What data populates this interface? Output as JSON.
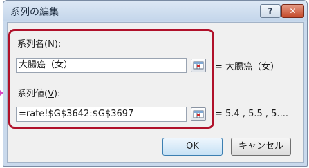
{
  "dialog": {
    "title": "系列の編集",
    "help_label": "?",
    "close_label": "✕"
  },
  "series_name": {
    "label_prefix": "系列名(",
    "label_accel": "N",
    "label_suffix": "):",
    "value": "大腸癌（女）",
    "preview": "= 大腸癌（女）"
  },
  "series_values": {
    "label_prefix": "系列値(",
    "label_accel": "V",
    "label_suffix": "):",
    "value": "=rate!$G$3642:$G$3697",
    "preview": "= 5.4 , 5.5 , 5...."
  },
  "buttons": {
    "ok": "OK",
    "cancel": "キャンセル"
  },
  "colors": {
    "highlight_border": "#b0112a",
    "pointer_arrow": "#d946c4"
  },
  "icons": {
    "range_picker": "range-picker-icon",
    "arrow": "pointer-arrow-icon"
  }
}
